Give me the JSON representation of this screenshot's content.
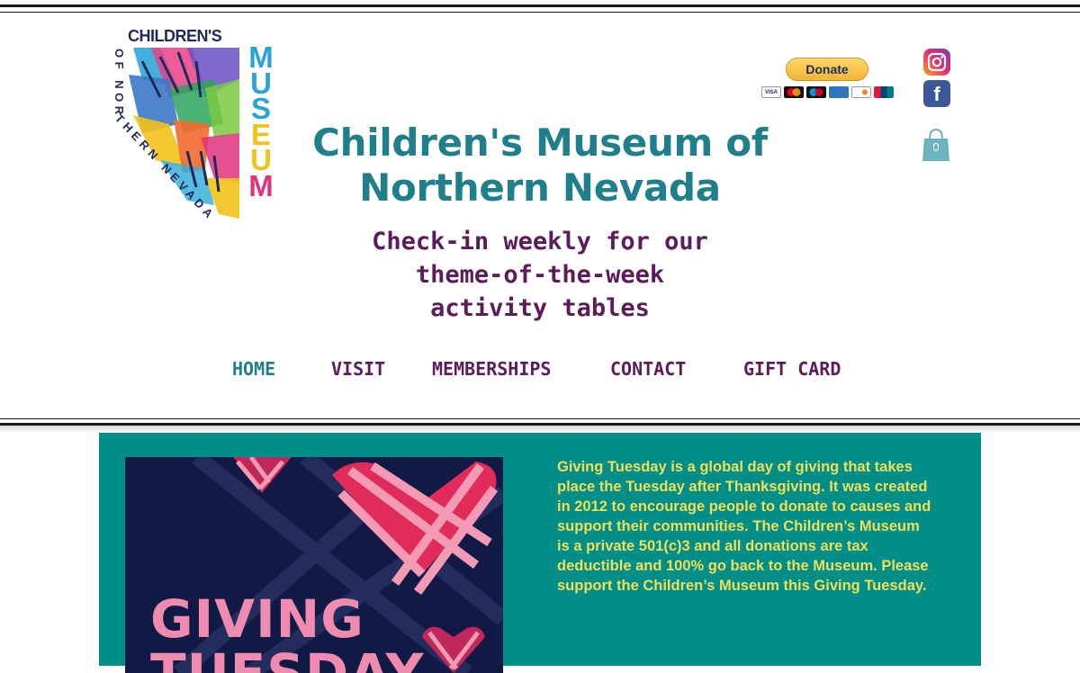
{
  "logo": {
    "top_text": "CHILDREN'S",
    "side_text": "OF NORTHERN NEVADA",
    "museum_letters": [
      "M",
      "U",
      "S",
      "E",
      "U",
      "M"
    ],
    "museum_colors": [
      "#2aa3d8",
      "#2aa3d8",
      "#2aa3d8",
      "#f2c21b",
      "#f2c21b",
      "#e0337c"
    ]
  },
  "header": {
    "title_line1": "Children's Museum of",
    "title_line2": "Northern Nevada",
    "tagline_line1": "Check-in weekly for our",
    "tagline_line2": "theme-of-the-week",
    "tagline_line3": "activity tables"
  },
  "donate": {
    "label": "Donate",
    "cards": [
      "VISA",
      "MC",
      "MAESTRO",
      "AMEX",
      "DISCOVER",
      "UNIONPAY"
    ]
  },
  "social": {
    "facebook_glyph": "f",
    "cart_count": "0"
  },
  "nav": {
    "items": [
      {
        "label": "HOME",
        "active": true
      },
      {
        "label": "VISIT",
        "active": false
      },
      {
        "label": "MEMBERSHIPS",
        "active": false
      },
      {
        "label": "CONTACT",
        "active": false
      },
      {
        "label": "GIFT CARD",
        "active": false
      }
    ]
  },
  "promo": {
    "line1": "GIVING",
    "line2": "TUESDAY"
  },
  "blurb": "Giving Tuesday is a global day of giving that takes place the Tuesday after Thanksgiving. It was created in 2012 to encourage people to donate to causes and support their communities. The Children’s Museum is a private 501(c)3 and all donations are tax deductible and 100% go back to the Museum. Please support the Children’s Museum this Giving Tuesday.",
  "colors": {
    "teal": "#1f7f8a",
    "plum": "#5c1c5a",
    "panel": "#008e88",
    "yellow_text": "#f1df5a",
    "promo_bg": "#111a45",
    "promo_pink": "#f08bb0"
  }
}
